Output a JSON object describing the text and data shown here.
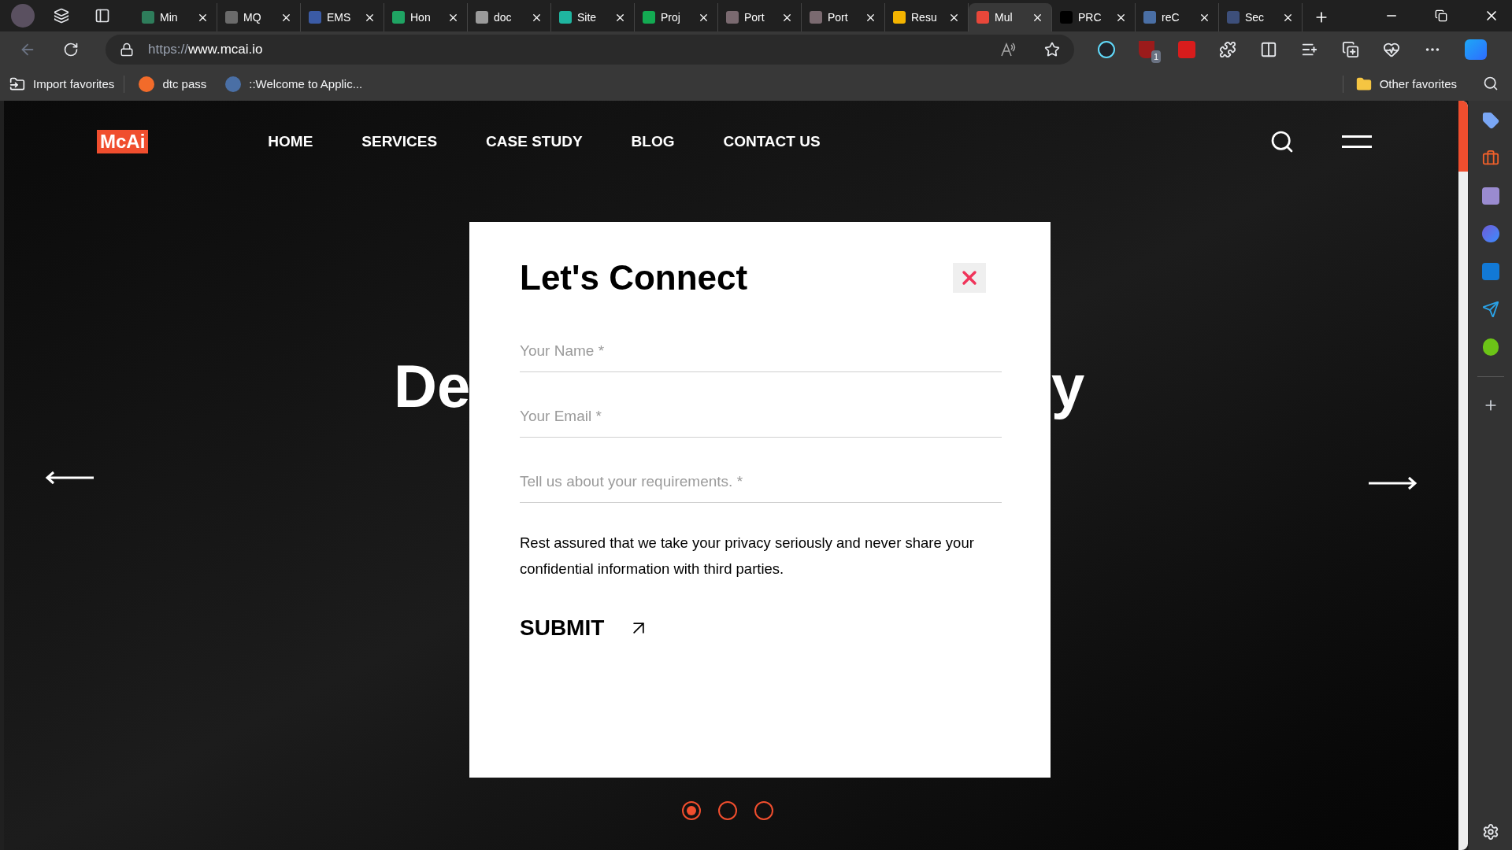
{
  "browser": {
    "tabs": [
      {
        "title": "Min",
        "color": "#2e7d5b",
        "selected": false
      },
      {
        "title": "MQ",
        "color": "#6b6b6b",
        "selected": false
      },
      {
        "title": "EMS",
        "color": "#3b5ba5",
        "selected": false
      },
      {
        "title": "Hon",
        "color": "#1fa463",
        "selected": false
      },
      {
        "title": "doc",
        "color": "#9a9a9a",
        "selected": false
      },
      {
        "title": "Site",
        "color": "#1fb5a0",
        "selected": false
      },
      {
        "title": "Proj",
        "color": "#13aa52",
        "selected": false
      },
      {
        "title": "Port",
        "color": "#7a6a70",
        "selected": false
      },
      {
        "title": "Port",
        "color": "#7a6a70",
        "selected": false
      },
      {
        "title": "Resu",
        "color": "#f4b400",
        "selected": false
      },
      {
        "title": "Mul",
        "color": "#e8473a",
        "selected": true
      },
      {
        "title": "PRC",
        "color": "#000000",
        "selected": false
      },
      {
        "title": "reC",
        "color": "#4a6fa5",
        "selected": false
      },
      {
        "title": "Sec",
        "color": "#3d4f7a",
        "selected": false
      }
    ],
    "url_scheme": "https://",
    "url_host": "www.mcai.io",
    "extension_badge": "1",
    "bookmarks": [
      {
        "label": "Import favorites"
      },
      {
        "label": "dtc pass"
      },
      {
        "label": "::Welcome to Applic..."
      }
    ],
    "other_favorites": "Other favorites"
  },
  "site": {
    "logo": "McAi",
    "nav": [
      "HOME",
      "SERVICES",
      "CASE STUDY",
      "BLOG",
      "CONTACT US"
    ],
    "hero_fragments": [
      "De",
      "y"
    ],
    "slides": [
      {
        "selected": true
      },
      {
        "selected": false
      },
      {
        "selected": false
      }
    ]
  },
  "modal": {
    "title": "Let's Connect",
    "fields": [
      {
        "placeholder": "Your Name *"
      },
      {
        "placeholder": "Your Email *"
      },
      {
        "placeholder": "Tell us about your requirements. *"
      }
    ],
    "privacy_note": "Rest assured that we take your privacy seriously and never share your confidential information with third parties.",
    "submit": "SUBMIT"
  }
}
